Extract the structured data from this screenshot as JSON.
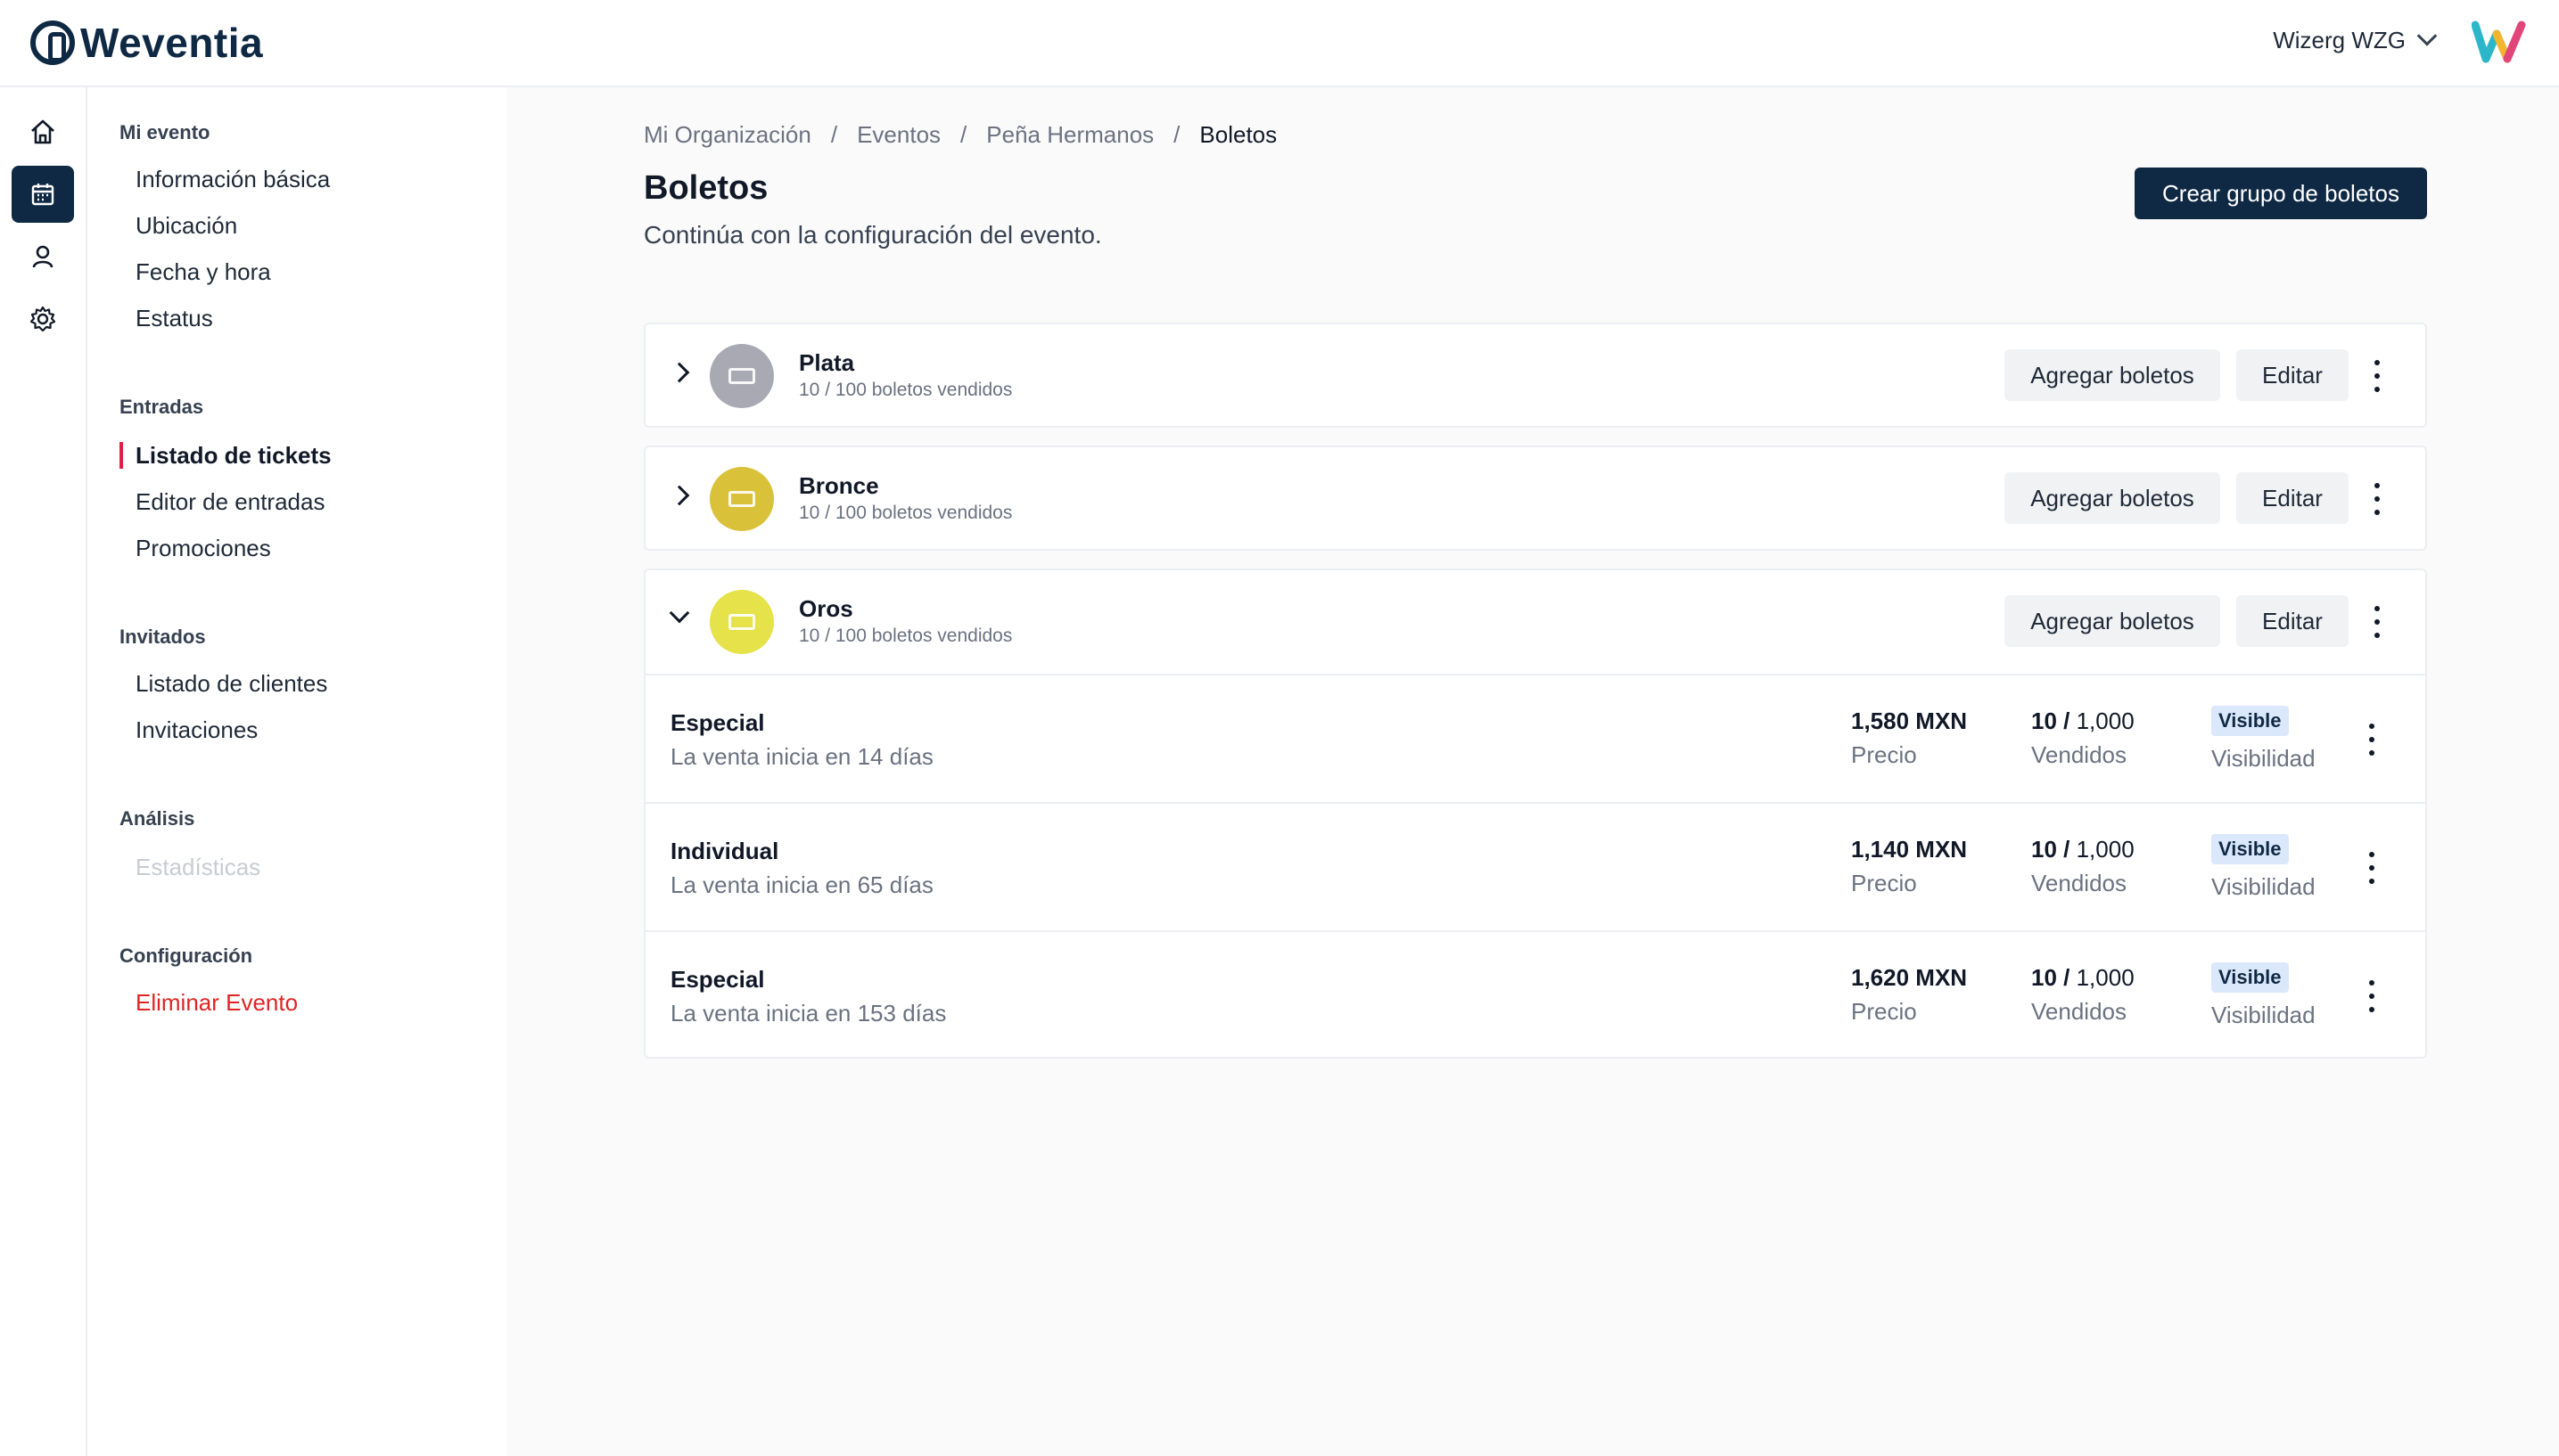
{
  "brand": {
    "name": "Weventia"
  },
  "header": {
    "user_name": "Wizerg WZG"
  },
  "rail": [
    {
      "icon": "home-icon"
    },
    {
      "icon": "calendar-icon",
      "active": true
    },
    {
      "icon": "user-icon"
    },
    {
      "icon": "gear-icon"
    }
  ],
  "subnav": {
    "sections": [
      {
        "title": "Mi evento",
        "items": [
          "Información básica",
          "Ubicación",
          "Fecha y hora",
          "Estatus"
        ]
      },
      {
        "title": "Entradas",
        "items": [
          "Listado de tickets",
          "Editor de entradas",
          "Promociones"
        ]
      },
      {
        "title": "Invitados",
        "items": [
          "Listado de clientes",
          "Invitaciones"
        ]
      },
      {
        "title": "Análisis",
        "items": [
          "Estadísticas"
        ]
      },
      {
        "title": "Configuración",
        "items": [
          "Eliminar Evento"
        ]
      }
    ]
  },
  "breadcrumb": [
    "Mi Organización",
    "Eventos",
    "Peña Hermanos",
    "Boletos"
  ],
  "breadcrumb_sep": "/",
  "page": {
    "title": "Boletos",
    "subtitle": "Continúa con la configuración del evento.",
    "create_button": "Crear grupo de boletos"
  },
  "groups": [
    {
      "name": "Plata",
      "sold": "10 / 100 boletos vendidos",
      "color": "#a9a9b3",
      "expanded": false
    },
    {
      "name": "Bronce",
      "sold": "10 / 100 boletos vendidos",
      "color": "#d9c23a",
      "expanded": false
    },
    {
      "name": "Oros",
      "sold": "10 / 100 boletos vendidos",
      "color": "#e6e24a",
      "expanded": true
    }
  ],
  "group_actions": {
    "add": "Agregar boletos",
    "edit": "Editar"
  },
  "tickets": [
    {
      "name": "Especial",
      "sale": "La venta inicia en 14 días",
      "price": "1,580 MXN",
      "price_label": "Precio",
      "sold": "10 /",
      "total": " 1,000",
      "sold_label": "Vendidos",
      "visibility": "Visible",
      "visibility_label": "Visibilidad"
    },
    {
      "name": "Individual",
      "sale": "La venta inicia en 65 días",
      "price": "1,140 MXN",
      "price_label": "Precio",
      "sold": "10 /",
      "total": " 1,000",
      "sold_label": "Vendidos",
      "visibility": "Visible",
      "visibility_label": "Visibilidad"
    },
    {
      "name": "Especial",
      "sale": "La venta inicia en 153 días",
      "price": "1,620 MXN",
      "price_label": "Precio",
      "sold": "10 /",
      "total": " 1,000",
      "sold_label": "Vendidos",
      "visibility": "Visible",
      "visibility_label": "Visibilidad"
    }
  ]
}
